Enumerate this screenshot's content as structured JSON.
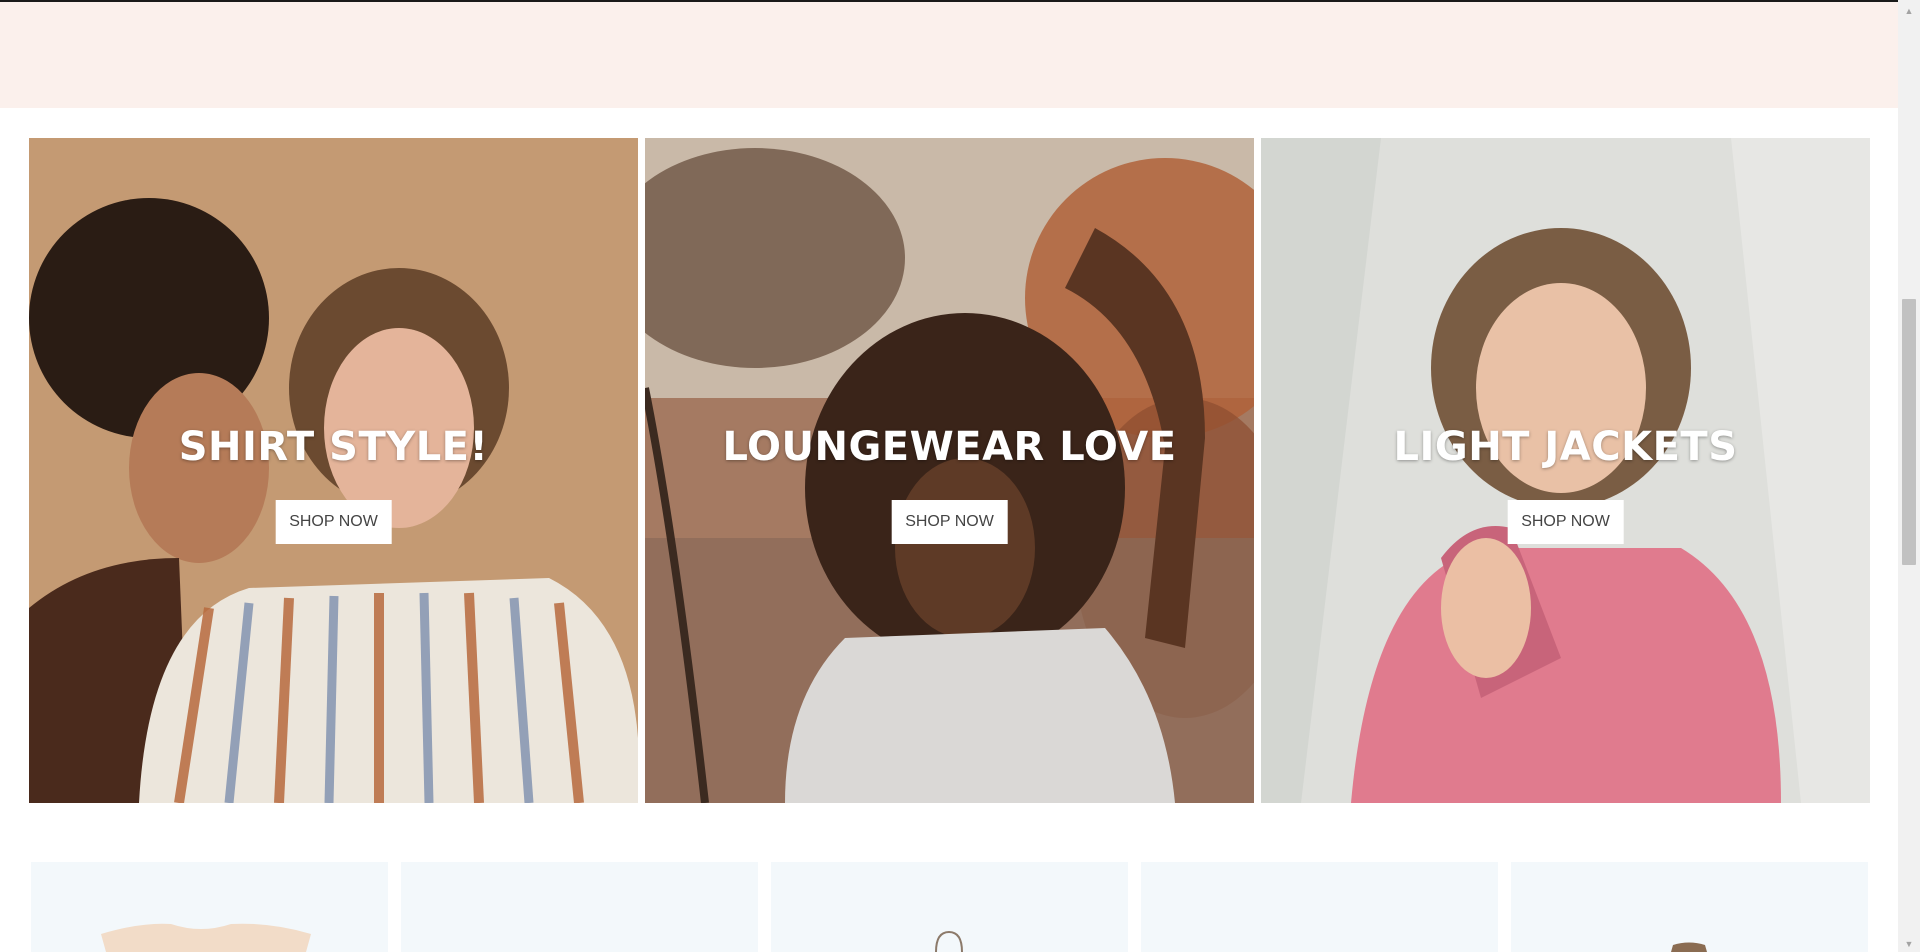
{
  "banners": [
    {
      "title": "SHIRT STYLE!",
      "button": "SHOP NOW"
    },
    {
      "title": "LOUNGEWEAR LOVE",
      "button": "SHOP NOW"
    },
    {
      "title": "LIGHT JACKETS",
      "button": "SHOP NOW"
    }
  ],
  "colors": {
    "header_band": "#fbf0ec",
    "product_card_bg": "#f3f8fb",
    "button_bg": "#ffffff",
    "button_text": "#444444"
  },
  "icons": {
    "scroll_up": "triangle-up-icon",
    "scroll_down": "triangle-down-icon"
  }
}
